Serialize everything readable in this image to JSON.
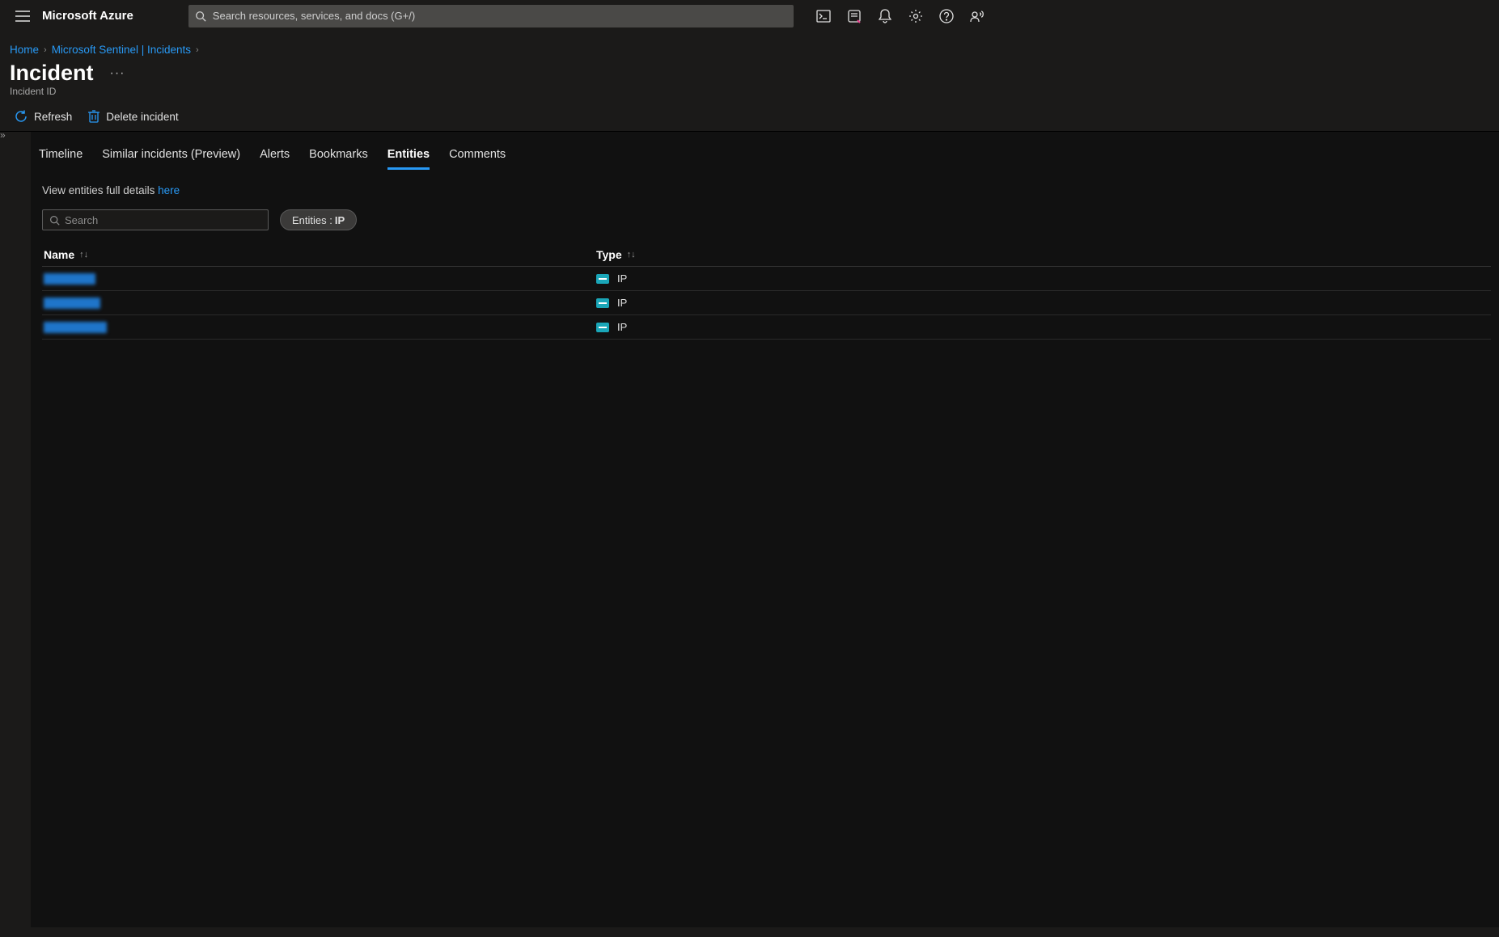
{
  "header": {
    "brand": "Microsoft Azure",
    "search_placeholder": "Search resources, services, and docs (G+/)"
  },
  "breadcrumbs": {
    "home": "Home",
    "sentinel": "Microsoft Sentinel | Incidents"
  },
  "page": {
    "title": "Incident",
    "subtitle": "Incident ID"
  },
  "toolbar": {
    "refresh": "Refresh",
    "delete": "Delete incident"
  },
  "tabs": {
    "timeline": "Timeline",
    "similar": "Similar incidents (Preview)",
    "alerts": "Alerts",
    "bookmarks": "Bookmarks",
    "entities": "Entities",
    "comments": "Comments"
  },
  "entities": {
    "hint_prefix": "View entities full details ",
    "hint_link": "here",
    "search_placeholder": "Search",
    "filter_label": "Entities :",
    "filter_value": "IP",
    "columns": {
      "name": "Name",
      "type": "Type"
    },
    "rows": [
      {
        "name_width": 64,
        "type": "IP"
      },
      {
        "name_width": 70,
        "type": "IP"
      },
      {
        "name_width": 78,
        "type": "IP"
      }
    ]
  }
}
